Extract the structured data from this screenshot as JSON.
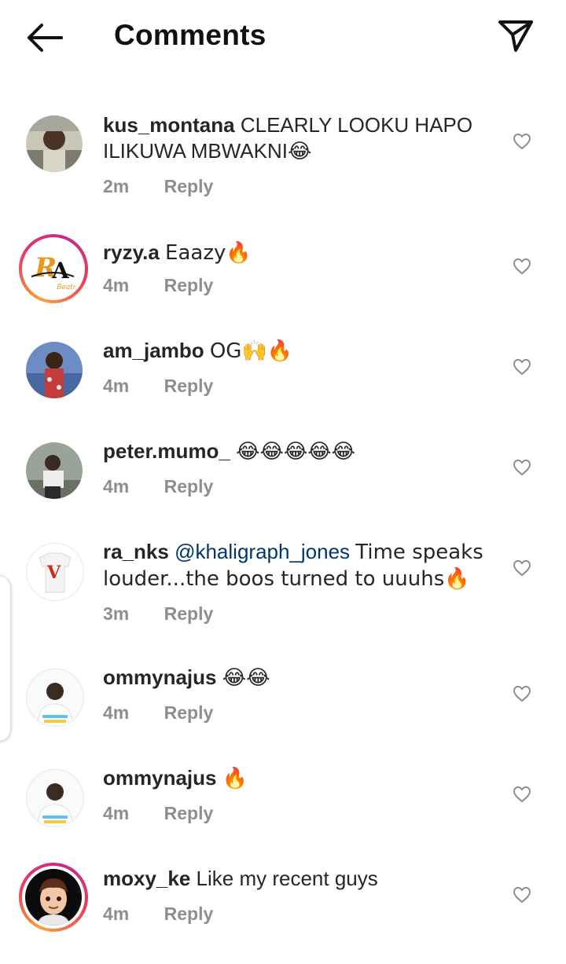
{
  "header": {
    "title": "Comments",
    "back_icon": "arrow-left-icon",
    "send_icon": "paper-plane-icon"
  },
  "comments": [
    {
      "username": "kus_montana",
      "text": "CLEARLY LOOKU HAPO ILIKUWA MBWAKNI😂",
      "time": "2m",
      "reply": "Reply"
    },
    {
      "username": "ryzy.a",
      "text": "Eaazy🔥",
      "time": "4m",
      "reply": "Reply"
    },
    {
      "username": "am_jambo",
      "text": "OG🙌🔥",
      "time": "4m",
      "reply": "Reply"
    },
    {
      "username": "peter.mumo_",
      "text": "😂😂😂😂😂",
      "time": "4m",
      "reply": "Reply"
    },
    {
      "username": "ra_nks",
      "mention": "@khaligraph_jones",
      "text": " Time speaks louder...the boos turned to uuuhs🔥",
      "time": "3m",
      "reply": "Reply"
    },
    {
      "username": "ommynajus",
      "text": "😂😂",
      "time": "4m",
      "reply": "Reply"
    },
    {
      "username": "ommynajus",
      "text": "🔥",
      "time": "4m",
      "reply": "Reply"
    },
    {
      "username": "moxy_ke",
      "text": "Like my recent guys",
      "time": "4m",
      "reply": "Reply"
    }
  ],
  "colors": {
    "text": "#262626",
    "meta": "#8e8e8e",
    "mention": "#00376b",
    "story_ring": "#e93d5f"
  }
}
